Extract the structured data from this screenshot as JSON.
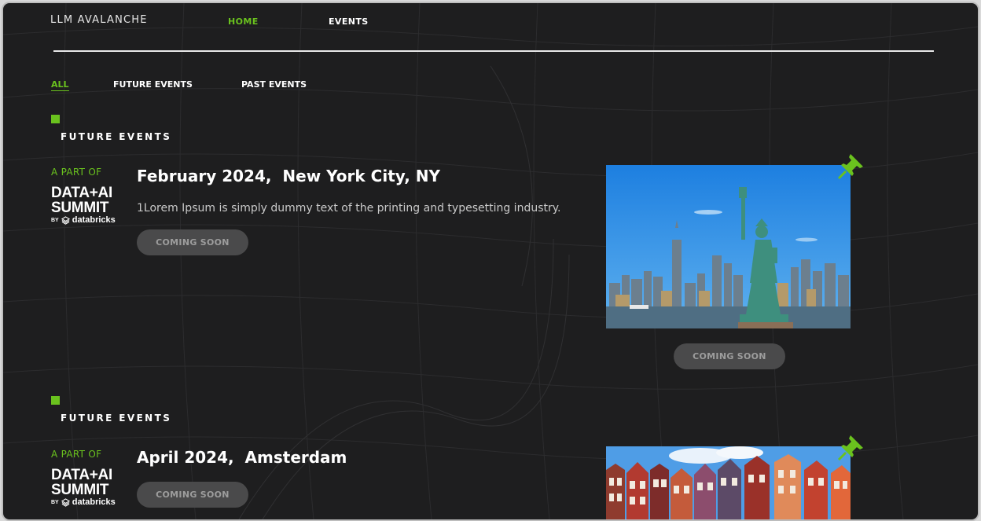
{
  "header": {
    "logo": "LLM AVALANCHE",
    "nav": [
      {
        "label": "HOME",
        "active": true
      },
      {
        "label": "EVENTS",
        "active": false
      }
    ]
  },
  "filters": [
    {
      "label": "ALL",
      "active": true
    },
    {
      "label": "FUTURE EVENTS",
      "active": false
    },
    {
      "label": "PAST EVENTS",
      "active": false
    }
  ],
  "events": [
    {
      "section_title": "FUTURE EVENTS",
      "part_of": "A PART OF",
      "brand_line1": "DATA+AI",
      "brand_line2": "SUMMIT",
      "brand_by": "BY",
      "brand_company": "databricks",
      "date": "February 2024,",
      "location": "New York City, NY",
      "description": "1Lorem Ipsum is simply dummy text of the printing and typesetting industry.",
      "button_label": "COMING SOON",
      "image_button_label": "COMING SOON",
      "image": "statue-of-liberty-new-york-skyline"
    },
    {
      "section_title": "FUTURE EVENTS",
      "part_of": "A PART OF",
      "brand_line1": "DATA+AI",
      "brand_line2": "SUMMIT",
      "brand_by": "BY",
      "brand_company": "databricks",
      "date": "April 2024,",
      "location": "Amsterdam",
      "button_label": "COMING SOON",
      "image": "amsterdam-canal-houses"
    }
  ],
  "colors": {
    "accent": "#6ac21e",
    "background": "#1e1e1f",
    "button_bg": "#4a4a4b",
    "button_text": "#9d9d9d"
  },
  "icons": [
    "pushpin-icon",
    "databricks-icon"
  ]
}
